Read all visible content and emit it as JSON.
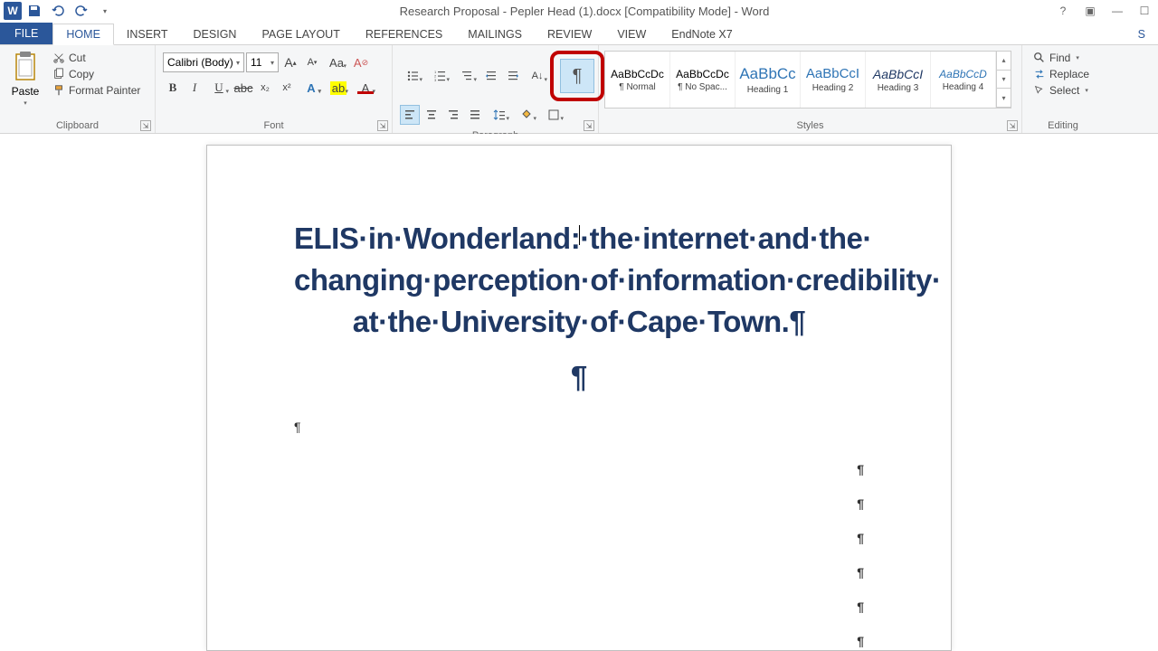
{
  "titlebar": {
    "title": "Research Proposal - Pepler Head (1).docx [Compatibility Mode] - Word"
  },
  "tabs": {
    "file": "FILE",
    "home": "HOME",
    "insert": "INSERT",
    "design": "DESIGN",
    "pageLayout": "PAGE LAYOUT",
    "references": "REFERENCES",
    "mailings": "MAILINGS",
    "review": "REVIEW",
    "view": "VIEW",
    "endnote": "EndNote X7"
  },
  "clipboard": {
    "paste": "Paste",
    "cut": "Cut",
    "copy": "Copy",
    "formatPainter": "Format Painter",
    "groupLabel": "Clipboard"
  },
  "font": {
    "name": "Calibri (Body)",
    "size": "11",
    "groupLabel": "Font"
  },
  "paragraph": {
    "groupLabel": "Paragraph"
  },
  "styles": {
    "items": [
      {
        "preview": "AaBbCcDc",
        "label": "¶ Normal",
        "color": "#000",
        "size": "12px",
        "style": "normal"
      },
      {
        "preview": "AaBbCcDc",
        "label": "¶ No Spac...",
        "color": "#000",
        "size": "12px",
        "style": "normal"
      },
      {
        "preview": "AaBbCc",
        "label": "Heading 1",
        "color": "#2e74b5",
        "size": "17px",
        "style": "normal"
      },
      {
        "preview": "AaBbCcI",
        "label": "Heading 2",
        "color": "#2e74b5",
        "size": "15px",
        "style": "normal"
      },
      {
        "preview": "AaBbCcI",
        "label": "Heading 3",
        "color": "#1f3864",
        "size": "14px",
        "style": "italic"
      },
      {
        "preview": "AaBbCcD",
        "label": "Heading 4",
        "color": "#2e74b5",
        "size": "12px",
        "style": "italic"
      }
    ],
    "groupLabel": "Styles"
  },
  "editing": {
    "find": "Find",
    "replace": "Replace",
    "select": "Select",
    "groupLabel": "Editing"
  },
  "document": {
    "title_line1": "ELIS·in·Wonderland:·the·internet·and·the·",
    "title_line2": "changing·perception·of·information·credibility·",
    "title_line3": "at·the·University·of·Cape·Town.¶",
    "pilcrow": "¶"
  }
}
